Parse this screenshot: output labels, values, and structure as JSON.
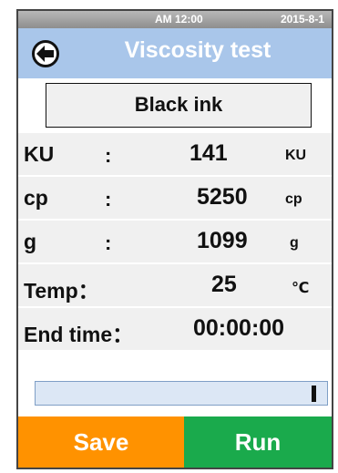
{
  "status": {
    "time": "AM 12:00",
    "date": "2015-8-1"
  },
  "header": {
    "title": "Viscosity test",
    "back_icon": "arrow-left-icon"
  },
  "sample": {
    "name": "Black ink"
  },
  "readings": [
    {
      "label": "KU",
      "colon": ":",
      "value": "141",
      "unit": "KU"
    },
    {
      "label": "cp",
      "colon": ":",
      "value": "5250",
      "unit": "cp"
    },
    {
      "label": "g",
      "colon": ":",
      "value": "1099",
      "unit": "g"
    },
    {
      "label": "Temp：",
      "value": "25",
      "unit": "℃"
    },
    {
      "label": "End time：",
      "value": "00:00:00"
    }
  ],
  "progress": {
    "fraction": 0.0
  },
  "actions": {
    "save_label": "Save",
    "run_label": "Run"
  },
  "colors": {
    "title_bar": "#a9c6ea",
    "save_button": "#ff9200",
    "run_button": "#1aaa4c",
    "progress_track": "#dce7f5"
  }
}
